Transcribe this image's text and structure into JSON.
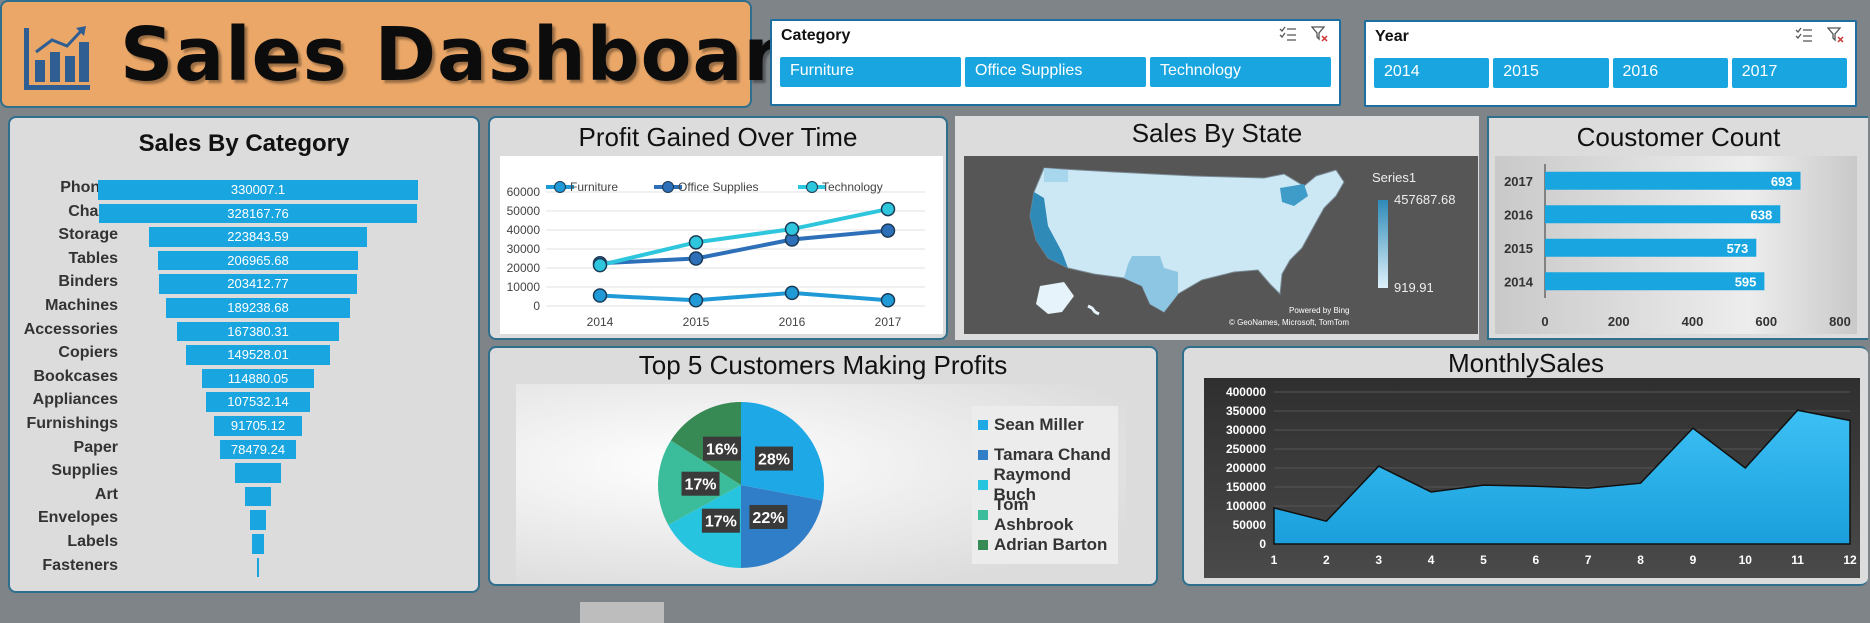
{
  "header": {
    "title": "Sales Dashboard"
  },
  "category_slicer": {
    "title": "Category",
    "items": [
      "Furniture",
      "Office Supplies",
      "Technology"
    ]
  },
  "year_slicer": {
    "title": "Year",
    "items": [
      "2014",
      "2015",
      "2016",
      "2017"
    ]
  },
  "accent": "#19a6e0",
  "sales_by_category": {
    "title": "Sales By Category",
    "chart_data": {
      "type": "bar",
      "categories": [
        "Phones",
        "Chairs",
        "Storage",
        "Tables",
        "Binders",
        "Machines",
        "Accessories",
        "Copiers",
        "Bookcases",
        "Appliances",
        "Furnishings",
        "Paper",
        "Supplies",
        "Art",
        "Envelopes",
        "Labels",
        "Fasteners"
      ],
      "values": [
        330007.1,
        328167.76,
        223843.59,
        206965.68,
        203412.77,
        189238.68,
        167380.31,
        149528.01,
        114880.05,
        107532.14,
        91705.12,
        78479.24,
        46673.54,
        27118.79,
        16476.4,
        12486.31,
        3024.28
      ],
      "labels": [
        "330007.1",
        "328167.76",
        "223843.59",
        "206965.68",
        "203412.77",
        "189238.68",
        "167380.31",
        "149528.01",
        "114880.05",
        "107532.14",
        "91705.12",
        "78479.24",
        "",
        "",
        "",
        "",
        ""
      ]
    }
  },
  "profit_over_time": {
    "title": "Profit Gained Over Time",
    "chart_data": {
      "type": "line",
      "x": [
        "2014",
        "2015",
        "2016",
        "2017"
      ],
      "ylim": [
        0,
        60000
      ],
      "yticks": [
        "0",
        "10000",
        "20000",
        "30000",
        "40000",
        "50000",
        "60000"
      ],
      "series": [
        {
          "name": "Furniture",
          "color": "#1f9ad6",
          "values": [
            5500,
            3000,
            6900,
            3000
          ]
        },
        {
          "name": "Office Supplies",
          "color": "#2d6fb8",
          "values": [
            22500,
            25000,
            35000,
            39700
          ]
        },
        {
          "name": "Technology",
          "color": "#2ec6dc",
          "values": [
            21500,
            33500,
            40500,
            51000
          ]
        }
      ]
    }
  },
  "sales_by_state": {
    "title": "Sales By State",
    "legend_title": "Series1",
    "max_label": "457687.68",
    "min_label": "919.91",
    "attribution_1": "Powered by Bing",
    "attribution_2": "© GeoNames, Microsoft, TomTom"
  },
  "customer_count": {
    "title": "Coustomer Count",
    "chart_data": {
      "type": "bar",
      "categories": [
        "2017",
        "2016",
        "2015",
        "2014"
      ],
      "values": [
        693,
        638,
        573,
        595
      ],
      "xlim": [
        0,
        800
      ],
      "xticks": [
        "0",
        "200",
        "400",
        "600",
        "800"
      ]
    }
  },
  "top_customers": {
    "title": "Top 5 Customers Making Profits",
    "chart_data": {
      "type": "pie",
      "categories": [
        "Sean Miller",
        "Tamara Chand",
        "Raymond Buch",
        "Tom Ashbrook",
        "Adrian Barton"
      ],
      "values": [
        28,
        22,
        17,
        17,
        16
      ],
      "labels": [
        "28%",
        "22%",
        "17%",
        "17%",
        "16%"
      ],
      "colors": [
        "#1ea9e6",
        "#2f7ec7",
        "#27c4e0",
        "#3bbc9b",
        "#388a55"
      ]
    }
  },
  "monthly_sales": {
    "title": "MonthlySales",
    "chart_data": {
      "type": "area",
      "x": [
        "1",
        "2",
        "3",
        "4",
        "5",
        "6",
        "7",
        "8",
        "9",
        "10",
        "11",
        "12"
      ],
      "values": [
        95000,
        60000,
        205000,
        137000,
        155000,
        152000,
        147000,
        160000,
        305000,
        200000,
        352000,
        325000
      ],
      "ylim": [
        0,
        400000
      ],
      "yticks": [
        "0",
        "50000",
        "100000",
        "150000",
        "200000",
        "250000",
        "300000",
        "350000",
        "400000"
      ]
    }
  }
}
